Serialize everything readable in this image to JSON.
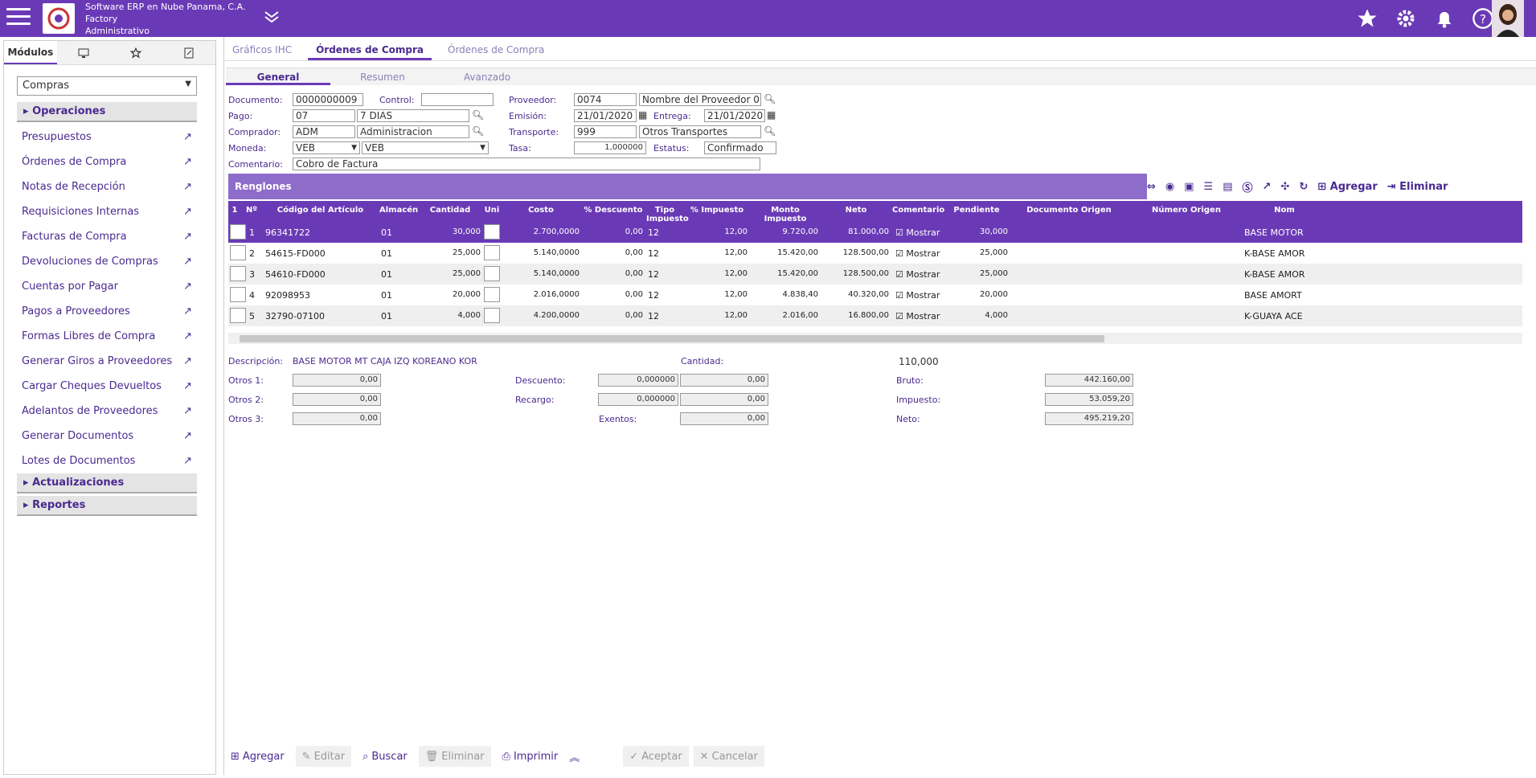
{
  "header": {
    "company": "Software ERP en Nube Panama, C.A.",
    "module": "Factory",
    "role": "Administrativo"
  },
  "left": {
    "tabs": [
      "Módulos"
    ],
    "select": "Compras",
    "sections": [
      "Operaciones",
      "Actualizaciones",
      "Reportes"
    ],
    "items": [
      "Presupuestos",
      "Órdenes de Compra",
      "Notas de Recepción",
      "Requisiciones Internas",
      "Facturas de Compra",
      "Devoluciones de Compras",
      "Cuentas por Pagar",
      "Pagos a Proveedores",
      "Formas Libres de Compra",
      "Generar Giros a Proveedores",
      "Cargar Cheques Devueltos",
      "Adelantos de Proveedores",
      "Generar Documentos",
      "Lotes de Documentos"
    ]
  },
  "tabs": [
    "Gráficos IHC",
    "Órdenes de Compra",
    "Órdenes de Compra"
  ],
  "subtabs": [
    "General",
    "Resumen",
    "Avanzado"
  ],
  "form": {
    "documento_l": "Documento:",
    "documento": "0000000009",
    "control_l": "Control:",
    "control": "",
    "proveedor_l": "Proveedor:",
    "proveedor": "0074",
    "proveedor_n": "Nombre del Proveedor 0",
    "pago_l": "Pago:",
    "pago": "07",
    "pago_d": "7 DIAS",
    "emision_l": "Emisión:",
    "emision": "21/01/2020",
    "entrega_l": "Entrega:",
    "entrega": "21/01/2020",
    "comprador_l": "Comprador:",
    "comprador": "ADM",
    "comprador_n": "Administracion",
    "transporte_l": "Transporte:",
    "transporte": "999",
    "transporte_n": "Otros Transportes",
    "moneda_l": "Moneda:",
    "moneda": "VEB",
    "moneda2": "VEB",
    "tasa_l": "Tasa:",
    "tasa": "1,000000",
    "estatus_l": "Estatus:",
    "estatus": "Confirmado",
    "comentario_l": "Comentario:",
    "comentario": "Cobro de Factura"
  },
  "grid": {
    "title": "Renglones",
    "agregar": "Agregar",
    "eliminar": "Eliminar",
    "headers": [
      "1",
      "Nº",
      "Código del Artículo",
      "Almacén",
      "Cantidad",
      "Uni",
      "Costo",
      "% Descuento",
      "Tipo Impuesto",
      "% Impuesto",
      "Monto Impuesto",
      "Neto",
      "Comentario",
      "Pendiente",
      "Documento Origen",
      "Número Origen",
      "Nom"
    ],
    "mostrar": "Mostrar",
    "rows": [
      [
        "1",
        "96341722",
        "01",
        "30,000",
        "2.700,0000",
        "0,00",
        "12",
        "12,00",
        "9.720,00",
        "81.000,00",
        "30,000",
        "BASE MOTOR"
      ],
      [
        "2",
        "54615-FD000",
        "01",
        "25,000",
        "5.140,0000",
        "0,00",
        "12",
        "12,00",
        "15.420,00",
        "128.500,00",
        "25,000",
        "K-BASE AMOR"
      ],
      [
        "3",
        "54610-FD000",
        "01",
        "25,000",
        "5.140,0000",
        "0,00",
        "12",
        "12,00",
        "15.420,00",
        "128.500,00",
        "25,000",
        "K-BASE AMOR"
      ],
      [
        "4",
        "92098953",
        "01",
        "20,000",
        "2.016,0000",
        "0,00",
        "12",
        "12,00",
        "4.838,40",
        "40.320,00",
        "20,000",
        "BASE AMORT"
      ],
      [
        "5",
        "32790-07100",
        "01",
        "4,000",
        "4.200,0000",
        "0,00",
        "12",
        "12,00",
        "2.016,00",
        "16.800,00",
        "4,000",
        "K-GUAYA ACE"
      ]
    ]
  },
  "summary": {
    "descripcion_l": "Descripción:",
    "descripcion": "BASE MOTOR MT CAJA IZQ KOREANO KOR",
    "cantidad_l": "Cantidad:",
    "cantidad": "110,000",
    "otros1_l": "Otros 1:",
    "otros1": "0,00",
    "otros2_l": "Otros 2:",
    "otros2": "0,00",
    "otros3_l": "Otros 3:",
    "otros3": "0,00",
    "descuento_l": "Descuento:",
    "descuento_p": "0,000000",
    "descuento": "0,00",
    "recargo_l": "Recargo:",
    "recargo_p": "0,000000",
    "recargo": "0,00",
    "exentos_l": "Exentos:",
    "exentos": "0,00",
    "bruto_l": "Bruto:",
    "bruto": "442.160,00",
    "impuesto_l": "Impuesto:",
    "impuesto": "53.059,20",
    "neto_l": "Neto:",
    "neto": "495.219,20"
  },
  "buttons": {
    "agregar": "Agregar",
    "editar": "Editar",
    "buscar": "Buscar",
    "eliminar": "Eliminar",
    "imprimir": "Imprimir",
    "aceptar": "Aceptar",
    "cancelar": "Cancelar"
  }
}
